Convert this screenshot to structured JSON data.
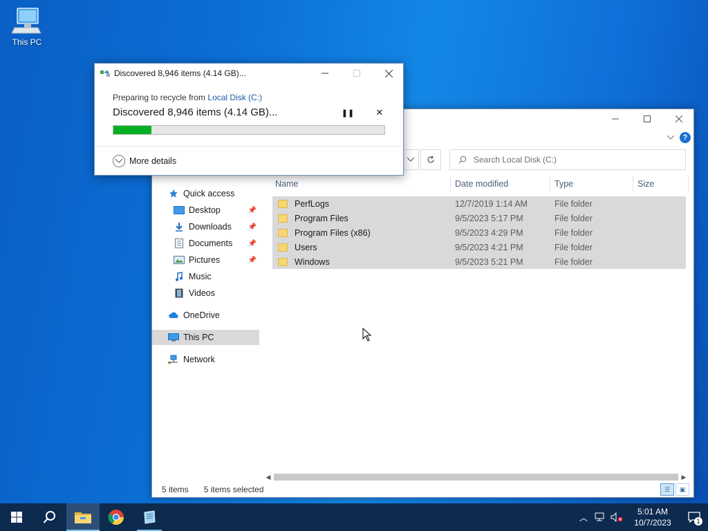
{
  "desktop": {
    "icons": [
      {
        "label": "This PC",
        "icon": "computer-icon"
      }
    ]
  },
  "explorer": {
    "search": {
      "placeholder": "Search Local Disk (C:)"
    },
    "nav": {
      "quick_access": "Quick access",
      "items": [
        {
          "label": "Desktop",
          "icon": "desktop-icon",
          "pinned": true
        },
        {
          "label": "Downloads",
          "icon": "downloads-icon",
          "pinned": true
        },
        {
          "label": "Documents",
          "icon": "documents-icon",
          "pinned": true
        },
        {
          "label": "Pictures",
          "icon": "pictures-icon",
          "pinned": true
        },
        {
          "label": "Music",
          "icon": "music-icon",
          "pinned": false
        },
        {
          "label": "Videos",
          "icon": "videos-icon",
          "pinned": false
        }
      ],
      "onedrive": "OneDrive",
      "this_pc": "This PC",
      "network": "Network"
    },
    "columns": {
      "name": "Name",
      "date": "Date modified",
      "type": "Type",
      "size": "Size"
    },
    "files": [
      {
        "name": "PerfLogs",
        "date": "12/7/2019 1:14 AM",
        "type": "File folder"
      },
      {
        "name": "Program Files",
        "date": "9/5/2023 5:17 PM",
        "type": "File folder"
      },
      {
        "name": "Program Files (x86)",
        "date": "9/5/2023 4:29 PM",
        "type": "File folder"
      },
      {
        "name": "Users",
        "date": "9/5/2023 4:21 PM",
        "type": "File folder"
      },
      {
        "name": "Windows",
        "date": "9/5/2023 5:21 PM",
        "type": "File folder"
      }
    ],
    "status": {
      "count": "5 items",
      "selected": "5 items selected"
    }
  },
  "dialog": {
    "title": "Discovered 8,946 items (4.14 GB)...",
    "sub_prefix": "Preparing to recycle from",
    "sub_link": "Local Disk (C:)",
    "main": "Discovered 8,946 items (4.14 GB)...",
    "progress_percent": 14,
    "more_details": "More details"
  },
  "taskbar": {
    "time": "5:01 AM",
    "date": "10/7/2023",
    "notifications": "1"
  }
}
